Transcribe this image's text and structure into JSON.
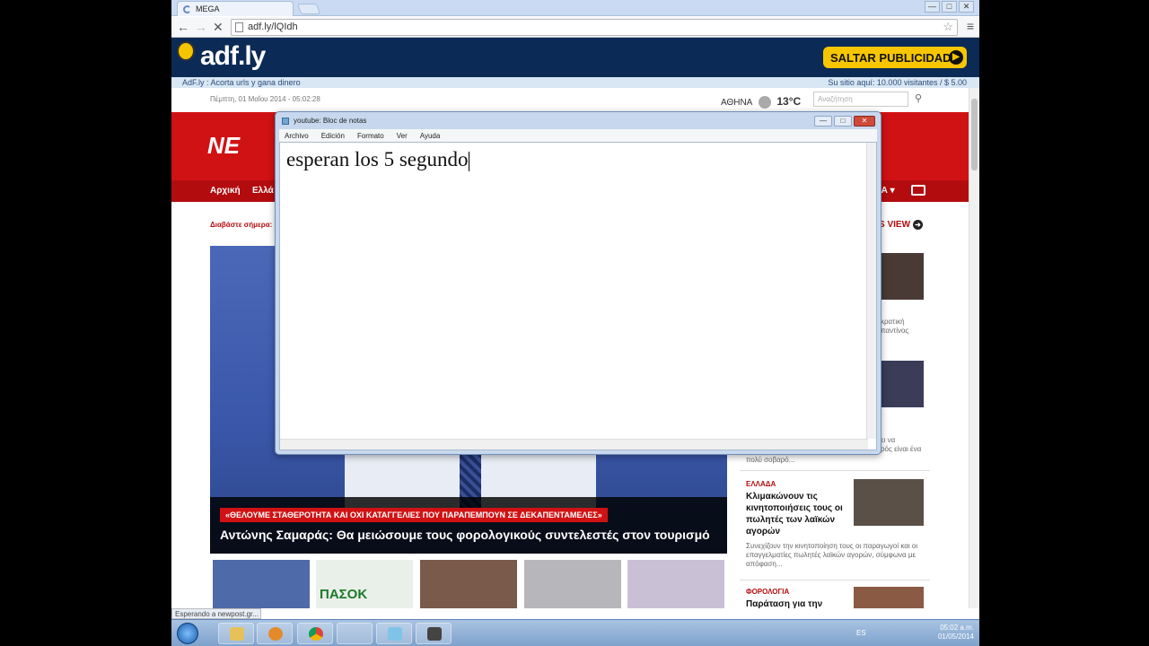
{
  "browser": {
    "tab_title": "MEGA",
    "url": "adf.ly/lQIdh",
    "window_controls": [
      "—",
      "□",
      "✕"
    ]
  },
  "adfly": {
    "logo_text": "adf.ly",
    "skip_label": "SALTAR PUBLICIDAD",
    "bar_left": "AdF.ly : Acorta urls y gana dinero",
    "bar_right": "Su sitio aquí: 10.000 visitantes / $ 5.00"
  },
  "site": {
    "date": "Πέμπτη, 01 Μαΐου 2014 - 05:02:28",
    "city": "ΑΘΗΝΑ",
    "temp": "13°C",
    "search_placeholder": "Αναζήτηση",
    "logo_partial": "NE",
    "nav_home": "Αρχική",
    "nav_second": "Ελλά",
    "nav_right": "ΕΡΑ ▾",
    "read_today": "Διαβάστε σήμερα:",
    "view_label": "S VIEW",
    "hero_kicker": "«ΘΕΛΟΥΜΕ ΣΤΑΘΕΡΟΤΗΤΑ ΚΑΙ ΟΧΙ ΚΑΤΑΓΓΕΛΙΕΣ ΠΟΥ ΠΑΡΑΠΕΜΠΟΥΝ ΣΕ ΔΕΚΑΠΕΝΤΑΜΕΛΕΣ»",
    "hero_headline": "Αντώνης Σαμαράς: Θα μειώσουμε τους φορολογικούς συντελεστές στον τουρισμό",
    "thumb_pasok": "ΠΑΣΟΚ",
    "side_frag_1a": "κρατική",
    "side_frag_1b": "παντίνος",
    "side_frag_2a": "ει να",
    "side_frag_2b": "ρός είναι ένα",
    "side_frag_2c": "πολύ σοβαρό...",
    "story_1_cat": "ΕΛΛΑΔΑ",
    "story_1_title": "Κλιμακώνουν τις κινητοποιήσεις τους οι πωλητές των λαϊκών αγορών",
    "story_1_text": "Συνεχίζουν την κινητοποίηση τους οι παραγωγοί και οι επαγγελματίες πωλητές λαϊκών αγορών, σύμφωνα με απόφαση...",
    "story_2_cat": "ΦΟΡΟΛΟΓΙΑ",
    "story_2_title": "Παράταση για την καταβολή ΦΠΑ",
    "status_text": "Esperando a newpost.gr..."
  },
  "notepad": {
    "title": "youtube: Bloc de notas",
    "menu": [
      "Archivo",
      "Edición",
      "Formato",
      "Ver",
      "Ayuda"
    ],
    "body": "esperan los 5 segundo"
  },
  "taskbar": {
    "lang": "ES",
    "time": "05:02 a.m.",
    "date": "01/05/2014"
  },
  "colors": {
    "adfly_bg": "#0b2a55",
    "site_red": "#d01214",
    "skip_yellow": "#f7c600"
  }
}
